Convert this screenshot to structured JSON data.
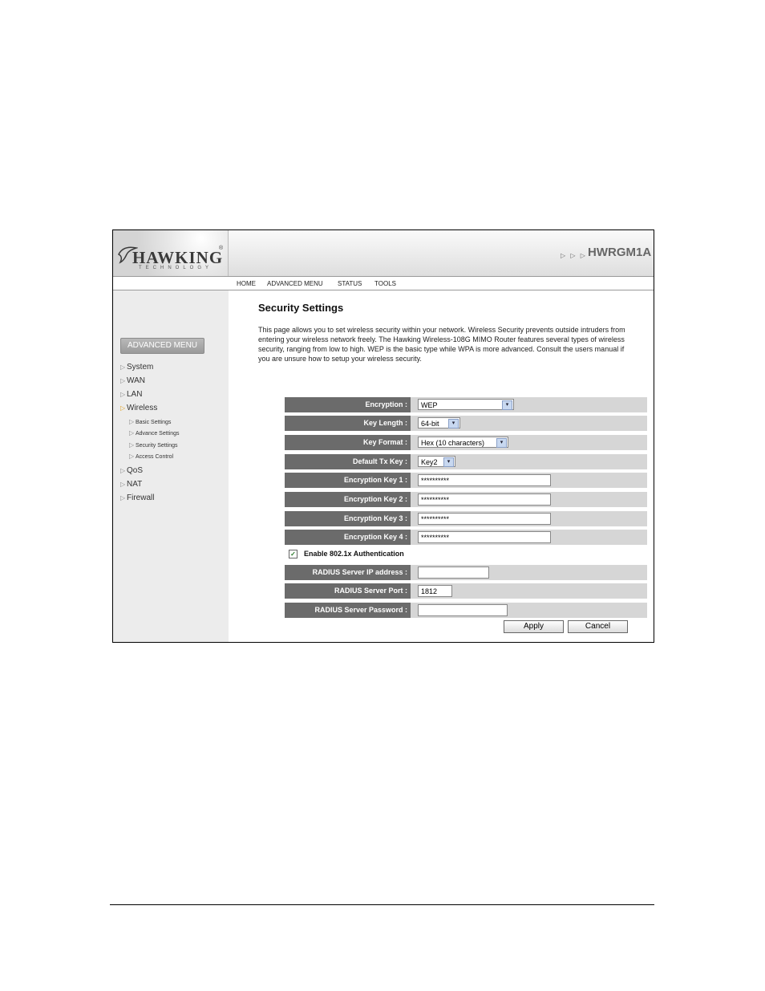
{
  "header": {
    "logo_text": "HAWKING",
    "logo_registered": "®",
    "logo_subtext": "TECHNOLOGY",
    "model_arrows": "▷ ▷ ▷",
    "model": "HWRGM1A"
  },
  "nav": [
    "HOME",
    "ADVANCED MENU",
    "STATUS",
    "TOOLS"
  ],
  "sidebar": {
    "button": "ADVANCED MENU",
    "items": [
      "System",
      "WAN",
      "LAN",
      "Wireless",
      "QoS",
      "NAT",
      "Firewall"
    ],
    "wireless_subitems": [
      "Basic Settings",
      "Advance Settings",
      "Security Settings",
      "Access Control"
    ]
  },
  "main": {
    "title": "Security Settings",
    "description": "This page allows you to set wireless security within your network. Wireless Security prevents outside intruders from entering your wireless network freely. The Hawking Wireless-108G MIMO Router features several types of wireless security, ranging from low to high. WEP is the basic type while WPA is more advanced. Consult the users manual if you are unsure how to setup your wireless security."
  },
  "form": {
    "encryption": {
      "label": "Encryption :",
      "value": "WEP"
    },
    "key_length": {
      "label": "Key Length :",
      "value": "64-bit"
    },
    "key_format": {
      "label": "Key Format :",
      "value": "Hex (10 characters)"
    },
    "default_tx_key": {
      "label": "Default Tx Key :",
      "value": "Key2"
    },
    "key1": {
      "label": "Encryption Key 1 :",
      "value": "**********"
    },
    "key2": {
      "label": "Encryption Key 2 :",
      "value": "**********"
    },
    "key3": {
      "label": "Encryption Key 3 :",
      "value": "**********"
    },
    "key4": {
      "label": "Encryption Key 4 :",
      "value": "**********"
    },
    "enable_8021x": {
      "label": "Enable 802.1x Authentication",
      "checked": true
    },
    "radius_ip": {
      "label": "RADIUS Server IP address :",
      "value": ""
    },
    "radius_port": {
      "label": "RADIUS Server Port :",
      "value": "1812"
    },
    "radius_password": {
      "label": "RADIUS Server Password :",
      "value": ""
    },
    "apply": "Apply",
    "cancel": "Cancel"
  },
  "icons": {
    "checkmark": "✓",
    "dropdown": "▾",
    "menu_arrow": "▷"
  },
  "colors": {
    "label_bg": "#6b6b6b",
    "row_bg": "#d6d6d6",
    "sidebar_bg": "#ececec",
    "active_arrow": "#e0a020"
  }
}
